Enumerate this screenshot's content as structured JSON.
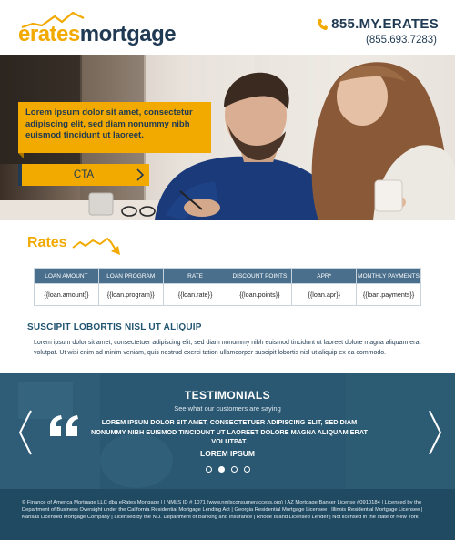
{
  "header": {
    "logo": {
      "part1": "erates",
      "part2": "mortgage"
    },
    "phone_main": "855.MY.ERATES",
    "phone_alt": "(855.693.7283)",
    "icons": {
      "phone": "phone-icon",
      "logo_swoosh": "logo-swoosh-icon"
    }
  },
  "hero": {
    "callout": "Lorem ipsum dolor sit amet, consectetur adipiscing elit, sed diam nonummy nibh euismod tincidunt ut laoreet.",
    "cta_label": "CTA",
    "icons": {
      "cta": "chevron-right-icon"
    }
  },
  "rates": {
    "title": "Rates",
    "columns": [
      "LOAN AMOUNT",
      "LOAN PROGRAM",
      "RATE",
      "DISCOUNT POINTS",
      "APR*",
      "MONTHLY PAYMENTS"
    ],
    "row": [
      "{{loan.amount}}",
      "{{loan.program}}",
      "{{loan.rate}}",
      "{{loan.points}}",
      "{{loan.apr}}",
      "{{loan.payments}}"
    ]
  },
  "article": {
    "heading": "SUSCIPIT LOBORTIS NISL UT ALIQUIP",
    "body": "Lorem ipsum dolor sit amet, consectetuer adipiscing elit, sed diam nonummy nibh euismod tincidunt ut laoreet dolore magna aliquam erat volutpat. Ut wisi enim ad minim veniam, quis nostrud exerci tation ullamcorper suscipit lobortis nisl ut aliquip ex ea commodo."
  },
  "testimonials": {
    "title": "TESTIMONIALS",
    "subtitle": "See what our customers are saying",
    "quote": "LOREM IPSUM DOLOR SIT AMET, CONSECTETUER ADIPISCING ELIT, SED DIAM NONUMMY NIBH EUISMOD TINCIDUNT UT LAOREET DOLORE MAGNA ALIQUAM ERAT VOLUTPAT.",
    "author": "LOREM IPSUM",
    "active_dot": 2,
    "dot_count": 4,
    "icons": {
      "prev": "chevron-left-icon",
      "next": "chevron-right-icon",
      "quote": "quote-icon"
    }
  },
  "footer": {
    "text": "© Finance of America Mortgage LLC dba eRates Mortgage |  | NMLS ID # 1071 (www.nmlsconsumeraccess.org) | AZ Mortgage Banker License #0910184 | Licensed by the Department of Business Oversight under the California Residential Mortgage Lending Act | Georgia Residential Mortgage Licensee | Illinois Residential Mortgage Licensee | Kansas Licensed Mortgage Company | Licensed by the N.J. Department of Banking and Insurance | Rhode Island Licensed Lender | Not licensed in the state of New York"
  },
  "colors": {
    "brand_navy": "#1f3a52",
    "brand_gold": "#f2a900",
    "table_header": "#4a6f8c",
    "testimonials_bg": "#2a5872",
    "footer_bg": "#1f4a62"
  }
}
